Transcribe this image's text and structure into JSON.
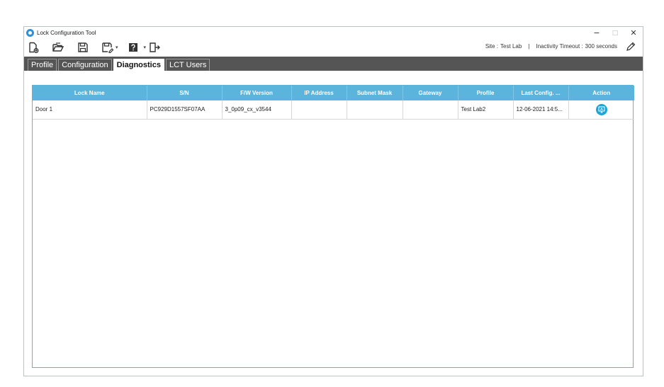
{
  "window": {
    "title": "Lock Configuration Tool",
    "controls": {
      "minimize": "−",
      "restore": "□",
      "close": "✕"
    }
  },
  "toolbar": {
    "icons": [
      "new-icon",
      "open-icon",
      "save-icon",
      "save-as-icon",
      "help-icon",
      "exit-icon"
    ],
    "caret": "▾",
    "site_label": "Site :",
    "site_value": "Test Lab",
    "separator": "|",
    "timeout_label": "Inactivity Timeout :",
    "timeout_value": "300 seconds"
  },
  "tabs": [
    {
      "label": "Profile",
      "active": false
    },
    {
      "label": "Configuration",
      "active": false
    },
    {
      "label": "Diagnostics",
      "active": true
    },
    {
      "label": "LCT Users",
      "active": false
    }
  ],
  "grid": {
    "columns": [
      "Lock Name",
      "S/N",
      "F/W Version",
      "IP Address",
      "Subnet Mask",
      "Gateway",
      "Profile",
      "Last Config. ...",
      "Action"
    ],
    "rows": [
      {
        "lock_name": "Door 1",
        "sn": "PC929D1557SF07AA",
        "fw_version": "3_0p09_cx_v3544",
        "ip_address": "",
        "subnet_mask": "",
        "gateway": "",
        "profile": "Test Lab2",
        "last_config": "12-06-2021 14:5...",
        "action_icon": "diagnostics-action-icon"
      }
    ]
  },
  "colors": {
    "accent": "#5ab4dc",
    "tabbar": "#555555",
    "action": "#1aa5d4"
  }
}
